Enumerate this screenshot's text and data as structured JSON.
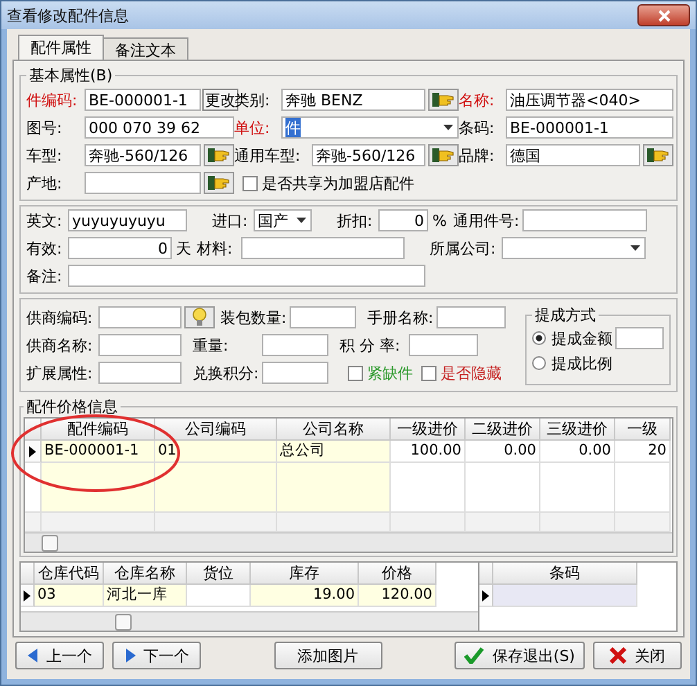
{
  "window": {
    "title": "查看修改配件信息"
  },
  "tabs": [
    {
      "label": "配件属性",
      "selected": true
    },
    {
      "label": "备注文本",
      "selected": false
    }
  ],
  "basic": {
    "title": "基本属性(B)",
    "rows": [
      [
        {
          "label": "件编码:",
          "required": true,
          "kind": "text_button",
          "value": "BE-000001-1",
          "button": "更改"
        },
        {
          "label": "类别:",
          "required": false,
          "kind": "lookup",
          "value": "奔驰    BENZ"
        },
        {
          "label": "名称:",
          "required": true,
          "kind": "text",
          "value": "油压调节器<040>"
        }
      ],
      [
        {
          "label": "图号:",
          "required": false,
          "kind": "text",
          "value": "000 070 39 62"
        },
        {
          "label": "单位:",
          "required": true,
          "kind": "combo",
          "value": "件",
          "highlighted": true
        },
        {
          "label": "条码:",
          "required": false,
          "kind": "text",
          "value": "BE-000001-1"
        }
      ],
      [
        {
          "label": "车型:",
          "required": false,
          "kind": "lookup",
          "value": "奔驰-560/126"
        },
        {
          "label": "通用车型:",
          "required": false,
          "kind": "lookup",
          "value": "奔驰-560/126"
        },
        {
          "label": "品牌:",
          "required": false,
          "kind": "lookup",
          "value": "德国"
        }
      ],
      [
        {
          "label": "产地:",
          "required": false,
          "kind": "lookup"
        },
        {
          "label": "是否共享为加盟店配件",
          "kind": "check",
          "checked": false
        }
      ]
    ]
  },
  "details": {
    "rows": [
      [
        {
          "label": "英文:",
          "kind": "text",
          "value": "yuyuyuyuyu"
        },
        {
          "label": "进口:",
          "kind": "combo",
          "value": "国产",
          "highlighted": false
        },
        {
          "label": "折扣:",
          "kind": "number",
          "value": "0",
          "suffix": "%"
        },
        {
          "label": "通用件号:",
          "kind": "text"
        }
      ],
      [
        {
          "label": "有效:",
          "kind": "number",
          "value": "0",
          "suffix": "天"
        },
        {
          "label": "材料:",
          "kind": "text"
        },
        {
          "label": "所属公司:",
          "kind": "combo"
        }
      ],
      [
        {
          "label": "备注:",
          "kind": "text"
        }
      ]
    ]
  },
  "supplier": {
    "rows": [
      [
        {
          "label": "供商编码:",
          "kind": "lookup"
        },
        {
          "label": "装包数量:",
          "kind": "text"
        },
        {
          "label": "手册名称:",
          "kind": "text"
        }
      ],
      [
        {
          "label": "供商名称:",
          "kind": "text"
        },
        {
          "label": "重量:",
          "kind": "text"
        },
        {
          "label": "积 分 率:",
          "kind": "text"
        }
      ],
      [
        {
          "label": "扩展属性:",
          "kind": "text"
        },
        {
          "label": "兑换积分:",
          "kind": "text"
        },
        {
          "label": "紧缺件",
          "kind": "check",
          "checked": false,
          "color": "#2e9a2e"
        },
        {
          "label": "是否隐藏",
          "kind": "check",
          "checked": false,
          "color": "#c42020"
        }
      ]
    ],
    "commission": {
      "title": "提成方式",
      "options": [
        {
          "label": "提成金额",
          "selected": true
        },
        {
          "label": "提成比例",
          "selected": false
        }
      ]
    }
  },
  "price_table": {
    "title": "配件价格信息",
    "columns": [
      "配件编码",
      "公司编码",
      "公司名称",
      "一级进价",
      "二级进价",
      "三级进价",
      "一级"
    ],
    "rows": [
      {
        "current": true,
        "cells": [
          "BE-000001-1",
          "01",
          "总公司",
          "100.00",
          "0.00",
          "0.00",
          "20"
        ]
      }
    ]
  },
  "stock_table": {
    "columns": [
      "仓库代码",
      "仓库名称",
      "货位",
      "库存",
      "价格"
    ],
    "rows": [
      {
        "current": true,
        "cells": [
          "03",
          "河北一库",
          null,
          "19.00",
          "120.00"
        ]
      }
    ]
  },
  "barcode_table": {
    "columns": [
      "条码"
    ],
    "rows": [
      {
        "current": true
      }
    ]
  },
  "buttons": [
    {
      "label": "上一个"
    },
    {
      "label": "下一个"
    },
    {
      "label": "添加图片"
    },
    {
      "label": "保存退出(S)"
    },
    {
      "label": "关闭"
    }
  ]
}
